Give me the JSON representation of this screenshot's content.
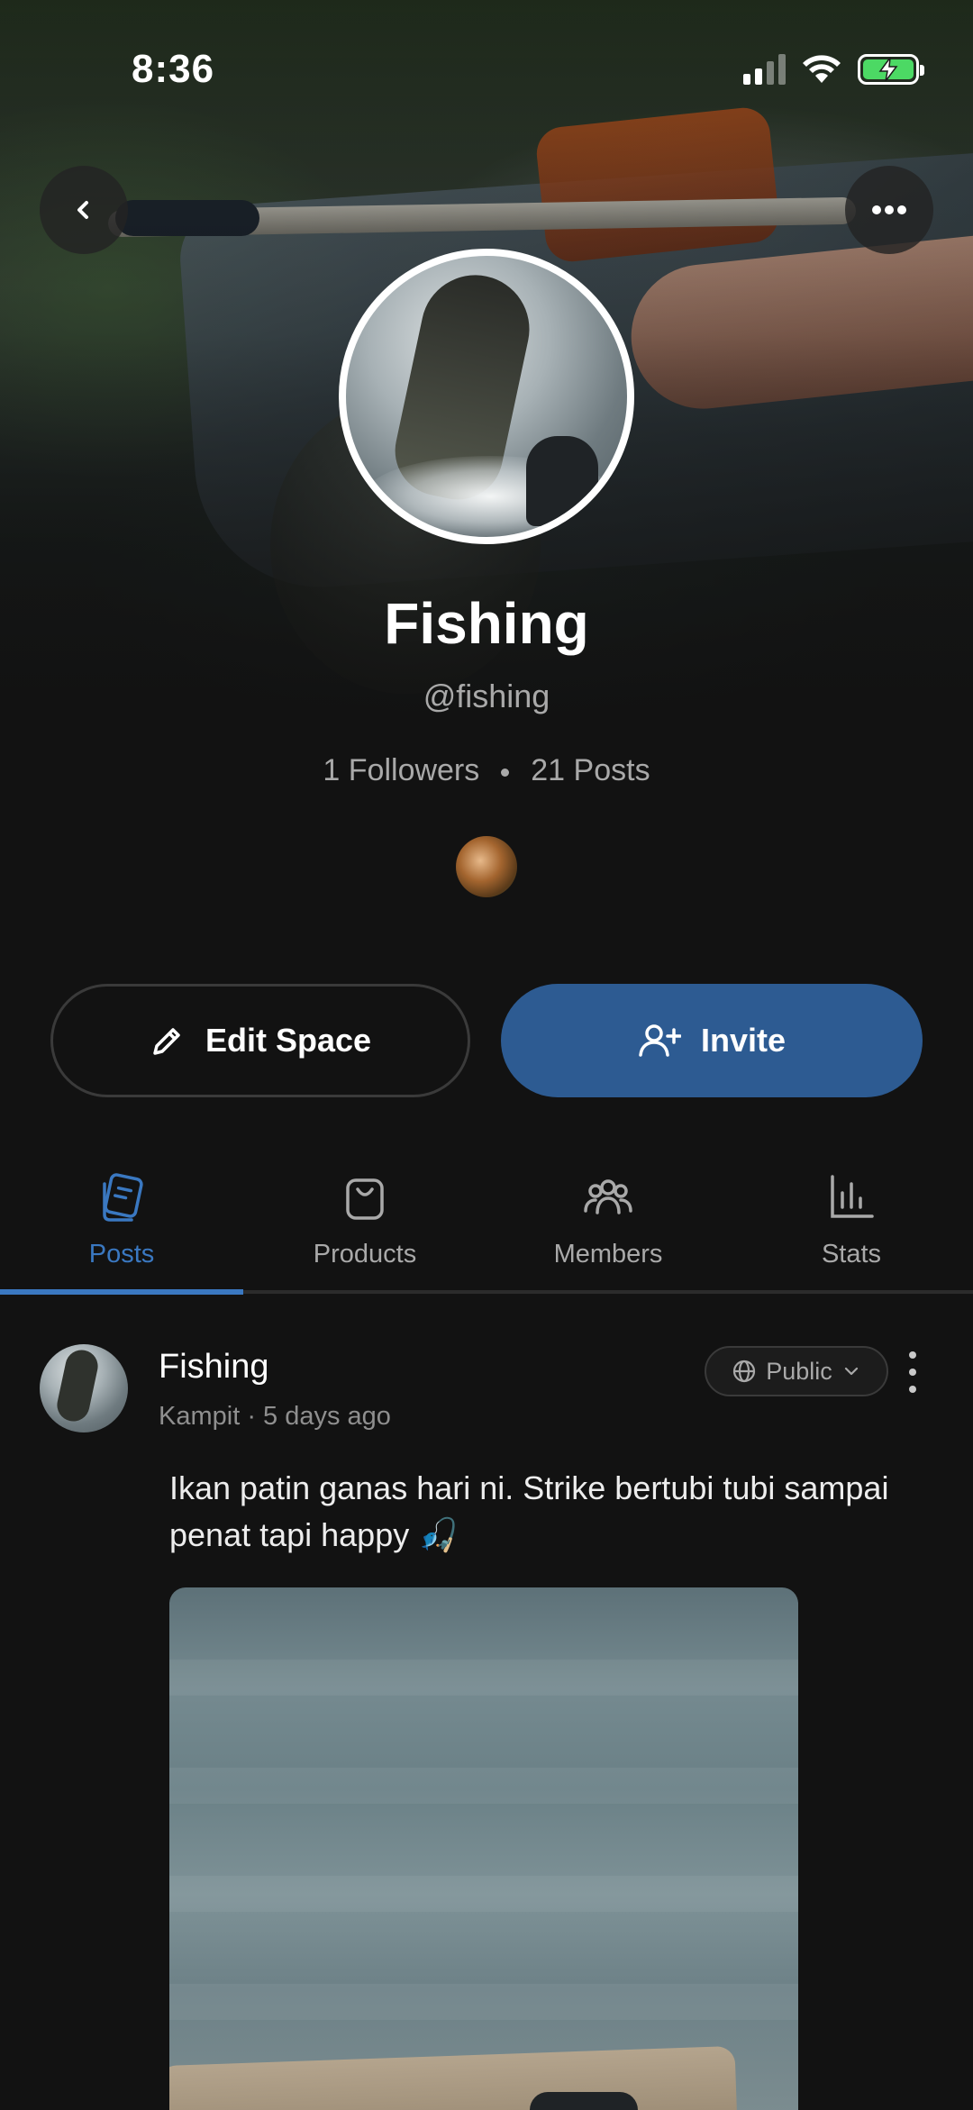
{
  "status_bar": {
    "time": "8:36"
  },
  "header": {
    "back_icon": "chevron-left-icon",
    "more_icon": "ellipsis-icon"
  },
  "space": {
    "name": "Fishing",
    "handle": "@fishing",
    "followers": "1 Followers",
    "posts": "21 Posts"
  },
  "actions": {
    "edit_label": "Edit Space",
    "edit_icon": "pencil-icon",
    "invite_label": "Invite",
    "invite_icon": "add-user-icon"
  },
  "tabs": [
    {
      "label": "Posts",
      "icon": "posts-icon",
      "active": true
    },
    {
      "label": "Products",
      "icon": "shopping-bag-icon",
      "active": false
    },
    {
      "label": "Members",
      "icon": "members-icon",
      "active": false
    },
    {
      "label": "Stats",
      "icon": "bar-chart-icon",
      "active": false
    }
  ],
  "post": {
    "author": "Fishing",
    "meta": "Kampit · 5 days ago",
    "visibility": "Public",
    "text": "Ikan patin ganas hari ni. Strike bertubi tubi sampai penat tapi happy 🎣"
  },
  "colors": {
    "accent": "#3a78c1",
    "invite_button": "#2d5b92",
    "background": "#121212",
    "battery": "#4cd964"
  }
}
